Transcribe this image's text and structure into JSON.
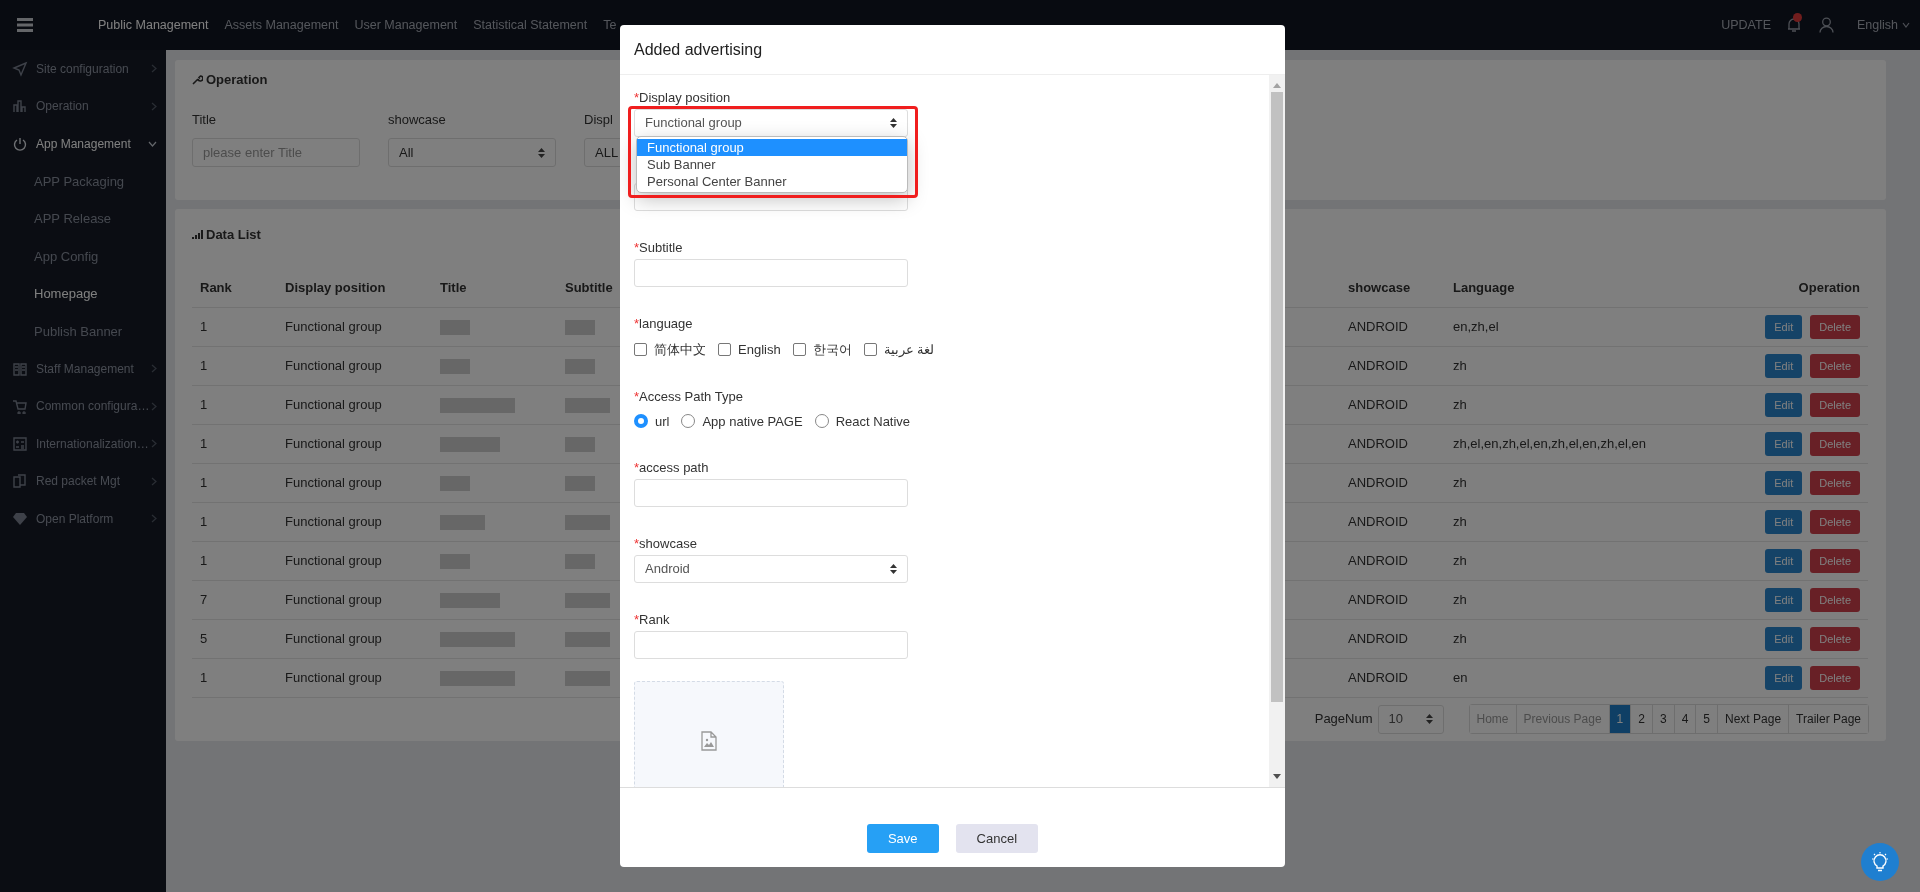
{
  "topbar": {
    "nav": [
      {
        "label": "Public Management",
        "selected": true
      },
      {
        "label": "Assets Management",
        "selected": false
      },
      {
        "label": "User Management",
        "selected": false
      },
      {
        "label": "Statistical Statement",
        "selected": false
      },
      {
        "label": "Te",
        "selected": false
      }
    ],
    "update": "UPDATE",
    "language": "English"
  },
  "sidebar": {
    "items": [
      {
        "label": "Site configuration",
        "expanded": false
      },
      {
        "label": "Operation",
        "expanded": false
      },
      {
        "label": "App Management",
        "expanded": true,
        "children": [
          {
            "label": "APP Packaging",
            "selected": false
          },
          {
            "label": "APP Release",
            "selected": false
          },
          {
            "label": "App Config",
            "selected": false
          },
          {
            "label": "Homepage",
            "selected": true
          },
          {
            "label": "Publish Banner",
            "selected": false
          }
        ]
      },
      {
        "label": "Staff Management",
        "expanded": false
      },
      {
        "label": "Common configura…",
        "expanded": false
      },
      {
        "label": "Internationalization…",
        "expanded": false
      },
      {
        "label": "Red packet Mgt",
        "expanded": false
      },
      {
        "label": "Open Platform",
        "expanded": false
      }
    ]
  },
  "filter": {
    "title": "Operation",
    "fields": [
      {
        "kind": "input",
        "label": "Title",
        "placeholder": "please enter Title"
      },
      {
        "kind": "select",
        "label": "showcase",
        "value": "All"
      },
      {
        "kind": "select",
        "label": "Displ",
        "value": "ALL"
      }
    ]
  },
  "data_list": {
    "title": "Data List",
    "columns": [
      "Rank",
      "Display position",
      "Title",
      "Subtitle",
      "showcase",
      "Language",
      "Operation"
    ],
    "rows": [
      {
        "rank": "1",
        "position": "Functional group",
        "showcase": "ANDROID",
        "language": "en,zh,el",
        "actions": [
          "Edit",
          "Delete"
        ]
      },
      {
        "rank": "1",
        "position": "Functional group",
        "showcase": "ANDROID",
        "language": "zh",
        "actions": [
          "Edit",
          "Delete"
        ]
      },
      {
        "rank": "1",
        "position": "Functional group",
        "showcase": "ANDROID",
        "language": "zh",
        "actions": [
          "Edit",
          "Delete"
        ]
      },
      {
        "rank": "1",
        "position": "Functional group",
        "showcase": "ANDROID",
        "language": "zh,el,en,zh,el,en,zh,el,en,zh,el,en",
        "actions": [
          "Edit",
          "Delete"
        ]
      },
      {
        "rank": "1",
        "position": "Functional group",
        "showcase": "ANDROID",
        "language": "zh",
        "actions": [
          "Edit",
          "Delete"
        ]
      },
      {
        "rank": "1",
        "position": "Functional group",
        "showcase": "ANDROID",
        "language": "zh",
        "actions": [
          "Edit",
          "Delete"
        ]
      },
      {
        "rank": "1",
        "position": "Functional group",
        "showcase": "ANDROID",
        "language": "zh",
        "actions": [
          "Edit",
          "Delete"
        ]
      },
      {
        "rank": "7",
        "position": "Functional group",
        "showcase": "ANDROID",
        "language": "zh",
        "actions": [
          "Edit",
          "Delete"
        ]
      },
      {
        "rank": "5",
        "position": "Functional group",
        "showcase": "ANDROID",
        "language": "zh",
        "actions": [
          "Edit",
          "Delete"
        ]
      },
      {
        "rank": "1",
        "position": "Functional group",
        "showcase": "ANDROID",
        "language": "en",
        "actions": [
          "Edit",
          "Delete"
        ]
      }
    ],
    "page_size_label": "PageNum",
    "page_size": "10",
    "pages": [
      {
        "label": "Home",
        "selected": false,
        "disabled": true
      },
      {
        "label": "Previous Page",
        "selected": false,
        "disabled": true
      },
      {
        "label": "1",
        "selected": true,
        "disabled": false
      },
      {
        "label": "2",
        "selected": false,
        "disabled": false
      },
      {
        "label": "3",
        "selected": false,
        "disabled": false
      },
      {
        "label": "4",
        "selected": false,
        "disabled": false
      },
      {
        "label": "5",
        "selected": false,
        "disabled": false
      },
      {
        "label": "Next Page",
        "selected": false,
        "disabled": false
      },
      {
        "label": "Trailer Page",
        "selected": false,
        "disabled": false
      }
    ]
  },
  "modal": {
    "title": "Added advertising",
    "fields": [
      {
        "kind": "select",
        "label": "Display position",
        "required_mark": "*",
        "value": "Functional group",
        "open": true,
        "highlighted": true,
        "options": [
          {
            "label": "Functional group",
            "selected": true
          },
          {
            "label": "Sub Banner",
            "selected": false
          },
          {
            "label": "Personal Center Banner",
            "selected": false
          }
        ]
      },
      {
        "kind": "input"
      },
      {
        "kind": "input",
        "label": "Subtitle",
        "required_mark": "*"
      },
      {
        "kind": "checkboxes",
        "label": "language",
        "required_mark": "*",
        "options": [
          {
            "label": "简体中文",
            "checked": false
          },
          {
            "label": "English",
            "checked": false
          },
          {
            "label": "한국어",
            "checked": false
          },
          {
            "label": "لغة عربية",
            "checked": false
          }
        ]
      },
      {
        "kind": "radios",
        "label": "Access Path Type",
        "required_mark": "*",
        "options": [
          {
            "label": "url",
            "selected": true
          },
          {
            "label": "App native PAGE",
            "selected": false
          },
          {
            "label": "React Native",
            "selected": false
          }
        ]
      },
      {
        "kind": "input",
        "label": "access path",
        "required_mark": "*"
      },
      {
        "kind": "select",
        "label": "showcase",
        "required_mark": "*",
        "value": "Android"
      },
      {
        "kind": "input",
        "label": "Rank",
        "required_mark": "*"
      },
      {
        "kind": "upload"
      }
    ],
    "buttons": [
      {
        "label": "Save",
        "kind": "primary"
      },
      {
        "label": "Cancel",
        "kind": "secondary"
      }
    ]
  }
}
